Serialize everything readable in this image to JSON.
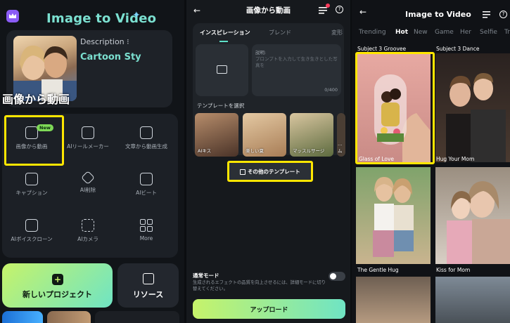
{
  "panel1": {
    "title": "Image to Video",
    "title_spark": "✦",
    "description_label": "Description",
    "description_value": "Cartoon Sty",
    "overlay_heading": "画像から動画",
    "new_badge": "New",
    "tools": [
      {
        "label": "画像から動画",
        "icon": "image-to-video-icon"
      },
      {
        "label": "AIリールメーカー",
        "icon": "reel-maker-icon"
      },
      {
        "label": "文章から動画生成",
        "icon": "text-to-video-icon"
      },
      {
        "label": "キャプション",
        "icon": "caption-icon"
      },
      {
        "label": "AI削除",
        "icon": "eraser-icon"
      },
      {
        "label": "AIビート",
        "icon": "beat-icon"
      },
      {
        "label": "AIボイスクローン",
        "icon": "voice-clone-icon"
      },
      {
        "label": "AIカメラ",
        "icon": "camera-icon"
      },
      {
        "label": "More",
        "icon": "more-grid-icon"
      }
    ],
    "new_project_label": "新しいプロジェクト",
    "resources_label": "リソース"
  },
  "panel2": {
    "title": "画像から動画",
    "tabs": [
      "インスピレーション",
      "ブレンド",
      "変形"
    ],
    "active_tab": "インスピレーション",
    "prompt_label": "説明:",
    "prompt_placeholder": "プロンプトを入力して生き生きとした写真を",
    "prompt_counter": "0/400",
    "templates_heading": "テンプレートを選択",
    "templates": [
      {
        "label": "AIキス"
      },
      {
        "label": "楽しい夏"
      },
      {
        "label": "マッスルサージ"
      },
      {
        "label": "…ム"
      }
    ],
    "more_templates_label": "その他のテンプレート",
    "mode_label": "通常モード",
    "mode_description": "生成されるエフェクトの品質を向上させるには、詳細モードに切り替えてください。",
    "mode_toggle": false,
    "upload_label": "アップロード"
  },
  "panel3": {
    "title": "Image to Video",
    "categories": [
      "Trending",
      "Hot",
      "New",
      "Game",
      "Her",
      "Selfie",
      "Tr"
    ],
    "active_category": "Hot",
    "top_captions": [
      "Subject 3 Groovee",
      "Subject 3 Dance"
    ],
    "videos": [
      {
        "caption": "Glass of Love"
      },
      {
        "caption": "Hug Your Mom"
      },
      {
        "caption": "The Gentle Hug"
      },
      {
        "caption": "Kiss for Mom"
      }
    ]
  },
  "colors": {
    "accent_teal": "#7be0d0",
    "highlight_yellow": "#ffe600",
    "new_green": "#7ed957",
    "gradient_start": "#c6f36a",
    "gradient_end": "#6fe4c4"
  }
}
